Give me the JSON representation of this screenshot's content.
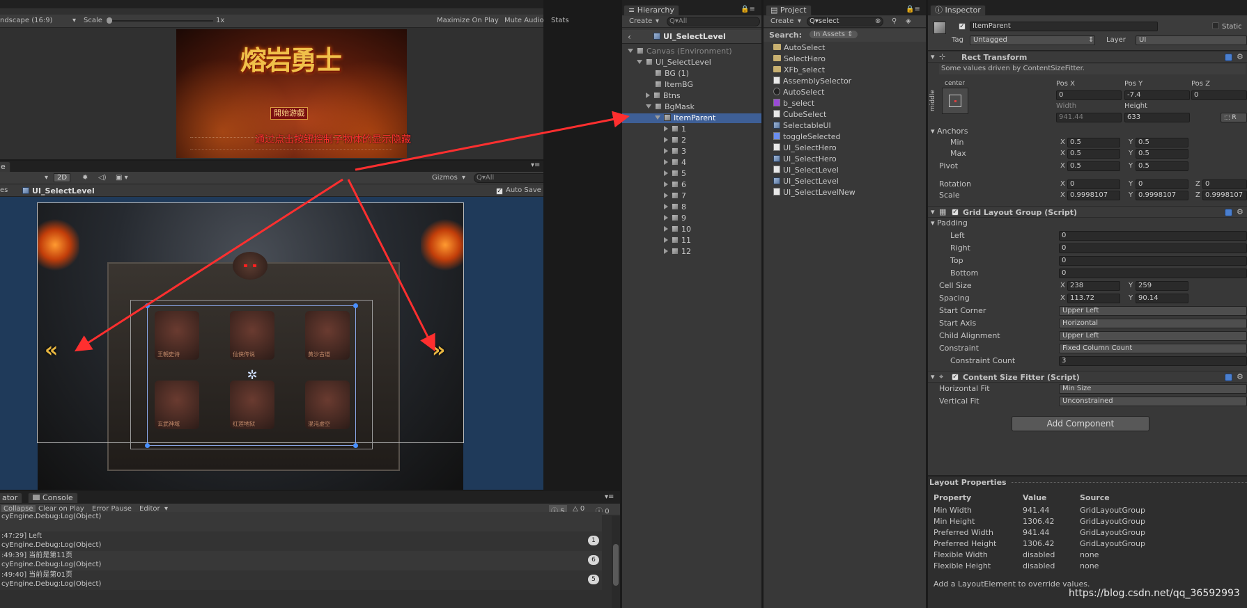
{
  "game": {
    "aspect": "ndscape (16:9)",
    "scale_label": "Scale",
    "scale_value": "1x",
    "maximize": "Maximize On Play",
    "mute": "Mute Audio",
    "stats": "Stats",
    "gizmos": "Gizmos",
    "title_line1": "熔岩勇士",
    "start_button": "開始游戲"
  },
  "annotation": "通过点击按钮控制子物体的显示隐藏",
  "scene": {
    "tab": "e",
    "mode_2d": "2D",
    "gizmos": "Gizmos",
    "search": "Q▾All",
    "breadcrumb_left": "es",
    "breadcrumb": "UI_SelectLevel",
    "autosave": "Auto Save",
    "level_labels": [
      "王朝史诗",
      "仙侠传说",
      "黄沙古道",
      "玄武神域",
      "红莲地狱",
      "混沌虚空"
    ]
  },
  "console": {
    "tab_left": "ator",
    "tab": "Console",
    "collapse": "Collapse",
    "clear_on_play": "Clear on Play",
    "error_pause": "Error Pause",
    "editor": "Editor",
    "count_log": "5",
    "count_warn": "0",
    "count_err": "0",
    "rows": [
      {
        "line1": "",
        "line2": "cyEngine.Debug:Log(Object)",
        "badge": ""
      },
      {
        "line1": ":47:29] Left",
        "line2": "cyEngine.Debug:Log(Object)",
        "badge": "1"
      },
      {
        "line1": ":49:39] 当前是第11页",
        "line2": "cyEngine.Debug:Log(Object)",
        "badge": "6"
      },
      {
        "line1": ":49:40] 当前是第01页",
        "line2": "cyEngine.Debug:Log(Object)",
        "badge": "5"
      }
    ]
  },
  "hierarchy": {
    "tab": "Hierarchy",
    "create": "Create",
    "search_placeholder": "Q▾All",
    "scene_name": "UI_SelectLevel",
    "items": [
      {
        "label": "Canvas (Environment)",
        "indent": 0,
        "arrow": "down",
        "icon": "gray"
      },
      {
        "label": "UI_SelectLevel",
        "indent": 1,
        "arrow": "down",
        "icon": "gray"
      },
      {
        "label": "BG (1)",
        "indent": 2,
        "arrow": "",
        "icon": "gray"
      },
      {
        "label": "ItemBG",
        "indent": 2,
        "arrow": "",
        "icon": "gray"
      },
      {
        "label": "Btns",
        "indent": 2,
        "arrow": "right",
        "icon": "gray"
      },
      {
        "label": "BgMask",
        "indent": 2,
        "arrow": "down",
        "icon": "gray"
      },
      {
        "label": "ItemParent",
        "indent": 3,
        "arrow": "down",
        "icon": "gray",
        "selected": true
      },
      {
        "label": "1",
        "indent": 4,
        "arrow": "right",
        "icon": "gray"
      },
      {
        "label": "2",
        "indent": 4,
        "arrow": "right",
        "icon": "gray"
      },
      {
        "label": "3",
        "indent": 4,
        "arrow": "right",
        "icon": "gray"
      },
      {
        "label": "4",
        "indent": 4,
        "arrow": "right",
        "icon": "gray"
      },
      {
        "label": "5",
        "indent": 4,
        "arrow": "right",
        "icon": "gray"
      },
      {
        "label": "6",
        "indent": 4,
        "arrow": "right",
        "icon": "gray"
      },
      {
        "label": "7",
        "indent": 4,
        "arrow": "right",
        "icon": "gray"
      },
      {
        "label": "8",
        "indent": 4,
        "arrow": "right",
        "icon": "gray"
      },
      {
        "label": "9",
        "indent": 4,
        "arrow": "right",
        "icon": "gray"
      },
      {
        "label": "10",
        "indent": 4,
        "arrow": "right",
        "icon": "gray"
      },
      {
        "label": "11",
        "indent": 4,
        "arrow": "right",
        "icon": "gray"
      },
      {
        "label": "12",
        "indent": 4,
        "arrow": "right",
        "icon": "gray"
      }
    ]
  },
  "project": {
    "tab": "Project",
    "create": "Create",
    "search_value": "Q▾select",
    "search_label": "Search:",
    "scope": "In Assets",
    "items": [
      {
        "label": "AutoSelect",
        "icon": "folder"
      },
      {
        "label": "SelectHero",
        "icon": "folder"
      },
      {
        "label": "XFb_select",
        "icon": "folder"
      },
      {
        "label": "AssemblySelector",
        "icon": "script"
      },
      {
        "label": "AutoSelect",
        "icon": "unity"
      },
      {
        "label": "b_select",
        "icon": "purple"
      },
      {
        "label": "CubeSelect",
        "icon": "script"
      },
      {
        "label": "SelectableUI",
        "icon": "cube"
      },
      {
        "label": "toggleSelected",
        "icon": "blue"
      },
      {
        "label": "UI_SelectHero",
        "icon": "script"
      },
      {
        "label": "UI_SelectHero",
        "icon": "cube"
      },
      {
        "label": "UI_SelectLevel",
        "icon": "script"
      },
      {
        "label": "UI_SelectLevel",
        "icon": "cube"
      },
      {
        "label": "UI_SelectLevelNew",
        "icon": "script"
      }
    ]
  },
  "inspector": {
    "tab": "Inspector",
    "object_name": "ItemParent",
    "static": "Static",
    "tag_label": "Tag",
    "tag_value": "Untagged",
    "layer_label": "Layer",
    "layer_value": "UI",
    "rect": {
      "title": "Rect Transform",
      "note": "Some values driven by ContentSizeFitter.",
      "anchor_h": "center",
      "anchor_v": "middle",
      "posx_label": "Pos X",
      "posy_label": "Pos Y",
      "posz_label": "Pos Z",
      "posx": "0",
      "posy": "-7.4",
      "posz": "0",
      "width_label": "Width",
      "height_label": "Height",
      "width": "941.44",
      "height": "633",
      "anchors_label": "Anchors",
      "min_label": "Min",
      "max_label": "Max",
      "pivot_label": "Pivot",
      "min_x": "0.5",
      "min_y": "0.5",
      "max_x": "0.5",
      "max_y": "0.5",
      "pivot_x": "0.5",
      "pivot_y": "0.5",
      "rotation_label": "Rotation",
      "rot_x": "0",
      "rot_y": "0",
      "rot_z": "0",
      "scale_label": "Scale",
      "scale_x": "0.9998107",
      "scale_y": "0.9998107",
      "scale_z": "0.9998107"
    },
    "grid": {
      "title": "Grid Layout Group (Script)",
      "padding_label": "Padding",
      "left_label": "Left",
      "right_label": "Right",
      "top_label": "Top",
      "bottom_label": "Bottom",
      "left": "0",
      "right": "0",
      "top": "0",
      "bottom": "0",
      "cell_label": "Cell Size",
      "cell_x": "238",
      "cell_y": "259",
      "spacing_label": "Spacing",
      "spacing_x": "113.72",
      "spacing_y": "90.14",
      "start_corner_label": "Start Corner",
      "start_corner": "Upper Left",
      "start_axis_label": "Start Axis",
      "start_axis": "Horizontal",
      "child_align_label": "Child Alignment",
      "child_align": "Upper Left",
      "constraint_label": "Constraint",
      "constraint": "Fixed Column Count",
      "constraint_count_label": "Constraint Count",
      "constraint_count": "3"
    },
    "fitter": {
      "title": "Content Size Fitter (Script)",
      "hfit_label": "Horizontal Fit",
      "hfit": "Min Size",
      "vfit_label": "Vertical Fit",
      "vfit": "Unconstrained"
    },
    "add_component": "Add Component",
    "layout": {
      "title": "Layout Properties",
      "headers": [
        "Property",
        "Value",
        "Source"
      ],
      "rows": [
        [
          "Min Width",
          "941.44",
          "GridLayoutGroup"
        ],
        [
          "Min Height",
          "1306.42",
          "GridLayoutGroup"
        ],
        [
          "Preferred Width",
          "941.44",
          "GridLayoutGroup"
        ],
        [
          "Preferred Height",
          "1306.42",
          "GridLayoutGroup"
        ],
        [
          "Flexible Width",
          "disabled",
          "none"
        ],
        [
          "Flexible Height",
          "disabled",
          "none"
        ]
      ],
      "footer": "Add a LayoutElement to override values."
    }
  },
  "watermark": "https://blog.csdn.net/qq_36592993",
  "colors": {
    "selection": "#3e5f96",
    "arrow": "#ff2f2f",
    "annotation": "#ff3030"
  }
}
